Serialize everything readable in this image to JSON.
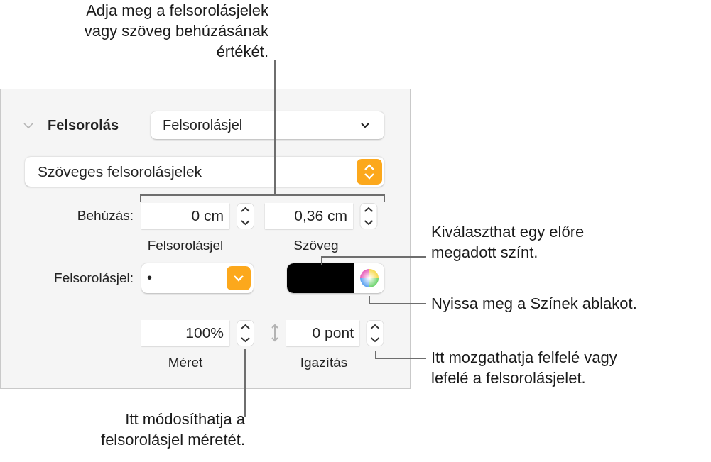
{
  "callouts": [
    {
      "kind": "top",
      "text": "Adja meg a felsorolásjelek\nvagy szöveg behúzásának\nértékét."
    },
    {
      "kind": "color",
      "text": "Kiválaszthat egy előre\nmegadott színt."
    },
    {
      "kind": "wheel",
      "text": "Nyissa meg a Színek ablakot."
    },
    {
      "kind": "align",
      "text": "Itt mozgathatja felfelé vagy\nlefelé a felsorolásjelet."
    },
    {
      "kind": "size",
      "text": "Itt módosíthatja a\nfelsorolásjel méretét."
    }
  ],
  "panel": {
    "section": {
      "title": "Felsorolás",
      "expanded": true,
      "style_value": "Felsorolásjel"
    },
    "type_value": "Szöveges felsorolásjelek",
    "indent": {
      "label": "Behúzás:",
      "bullet_value": "0 cm",
      "bullet_caption": "Felsorolásjel",
      "text_value": "0,36 cm",
      "text_caption": "Szöveg"
    },
    "bullet": {
      "label": "Felsorolásjel:",
      "value": "•"
    },
    "size": {
      "value": "100%",
      "caption": "Méret"
    },
    "align": {
      "value": "0 pont",
      "caption": "Igazítás"
    }
  }
}
